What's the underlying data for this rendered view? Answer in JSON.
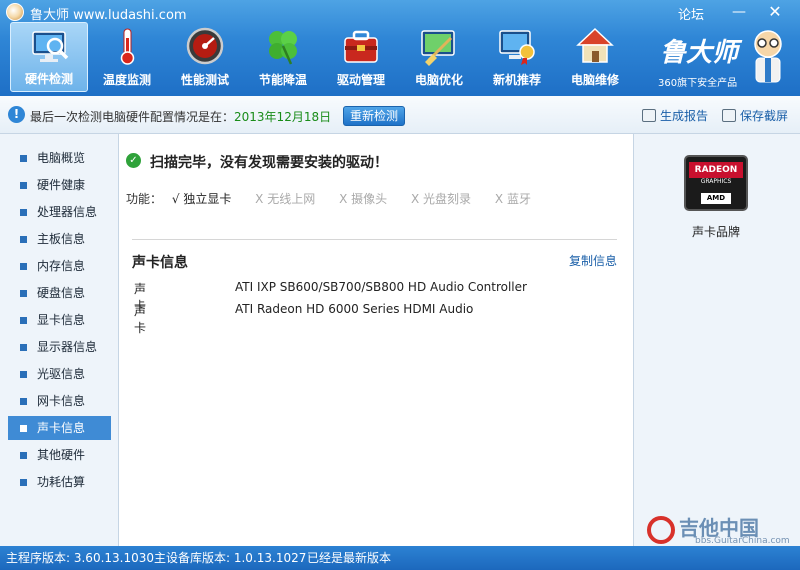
{
  "app": {
    "title": "鲁大师 www.ludashi.com",
    "forum": "论坛",
    "minimize": "—",
    "close": "✕"
  },
  "toolbar": {
    "items": [
      {
        "label": "硬件检测",
        "icon": "monitor-magnifier-icon",
        "active": true
      },
      {
        "label": "温度监测",
        "icon": "thermometer-icon",
        "active": false
      },
      {
        "label": "性能测试",
        "icon": "speedometer-icon",
        "active": false
      },
      {
        "label": "节能降温",
        "icon": "clover-icon",
        "active": false
      },
      {
        "label": "驱动管理",
        "icon": "toolbox-icon",
        "active": false
      },
      {
        "label": "电脑优化",
        "icon": "broom-screen-icon",
        "active": false
      },
      {
        "label": "新机推荐",
        "icon": "new-pc-medal-icon",
        "active": false
      },
      {
        "label": "电脑维修",
        "icon": "house-wrench-icon",
        "active": false
      }
    ]
  },
  "brand": {
    "name": "鲁大师",
    "tagline": "360旗下安全产品"
  },
  "infobar": {
    "text": "最后一次检测电脑硬件配置情况是在：",
    "date": "2013年12月18日",
    "recheck": "重新检测",
    "report": "生成报告",
    "screenshot": "保存截屏"
  },
  "sidebar": {
    "items": [
      {
        "label": "电脑概览"
      },
      {
        "label": "硬件健康"
      },
      {
        "label": "处理器信息"
      },
      {
        "label": "主板信息"
      },
      {
        "label": "内存信息"
      },
      {
        "label": "硬盘信息"
      },
      {
        "label": "显卡信息"
      },
      {
        "label": "显示器信息"
      },
      {
        "label": "光驱信息"
      },
      {
        "label": "网卡信息"
      },
      {
        "label": "声卡信息",
        "active": true
      },
      {
        "label": "其他硬件"
      },
      {
        "label": "功耗估算"
      }
    ]
  },
  "main": {
    "status": "扫描完毕，没有发现需要安装的驱动！",
    "features_label": "功能：",
    "features": [
      {
        "mark": "√",
        "label": "独立显卡",
        "enabled": true
      },
      {
        "mark": "X",
        "label": "无线上网",
        "enabled": false
      },
      {
        "mark": "X",
        "label": "摄像头",
        "enabled": false
      },
      {
        "mark": "X",
        "label": "光盘刻录",
        "enabled": false
      },
      {
        "mark": "X",
        "label": "蓝牙",
        "enabled": false
      }
    ],
    "section_title": "声卡信息",
    "copy": "复制信息",
    "rows": [
      {
        "key": "声卡",
        "value": "ATI IXP SB600/SB700/SB800 HD Audio Controller"
      },
      {
        "key": "声卡",
        "value": "ATI Radeon HD 6000 Series HDMI Audio"
      }
    ]
  },
  "right": {
    "logo_text": "RADEON",
    "logo_sub": "GRAPHICS",
    "logo_amd": "AMD",
    "caption": "声卡品牌"
  },
  "watermark": {
    "main": "吉他中国",
    "sub": "bbs.GuitarChina.com"
  },
  "statusbar": {
    "program_version": "主程序版本: 3.60.13.1030",
    "db_version": "主设备库版本: 1.0.13.1027",
    "latest": "已经是最新版本"
  },
  "colors": {
    "accent": "#2f86d6",
    "date_green": "#198c19",
    "link_blue": "#1a5fa8",
    "selected_item": "#3f8bd5"
  }
}
